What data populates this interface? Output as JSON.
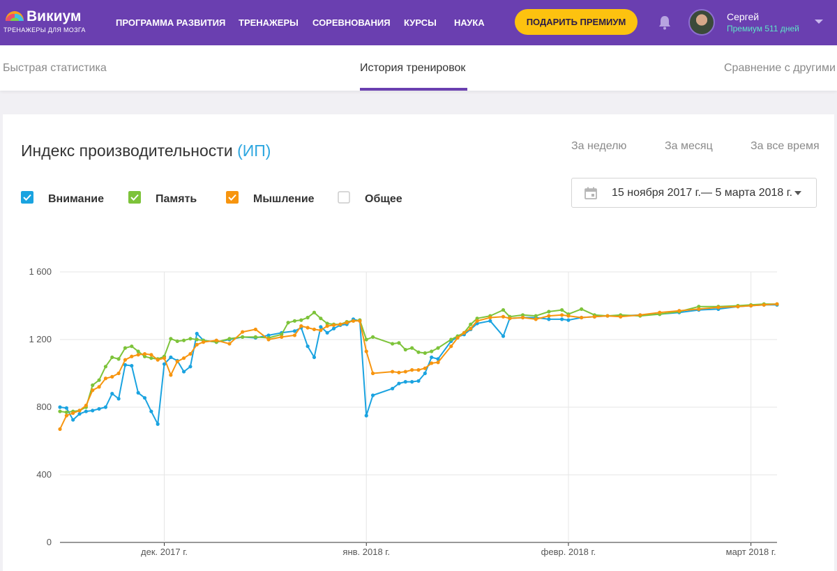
{
  "header": {
    "logo_name": "Викиум",
    "logo_tagline": "ТРЕНАЖЕРЫ ДЛЯ МОЗГА",
    "nav": [
      "ПРОГРАММА РАЗВИТИЯ",
      "ТРЕНАЖЕРЫ",
      "СОРЕВНОВАНИЯ",
      "КУРСЫ",
      "НАУКА"
    ],
    "premium_button": "ПОДАРИТЬ ПРЕМИУМ",
    "user_name": "Сергей",
    "user_status": "Премиум 511 дней",
    "colors": {
      "bar": "#6a3fb0",
      "button": "#fdc20f",
      "status": "#5ee4c8"
    }
  },
  "tabs": {
    "items": [
      "Быстрая статистика",
      "История тренировок",
      "Сравнение с другими"
    ],
    "active": "История тренировок"
  },
  "card": {
    "title": "Индекс производительности",
    "title_abbr": "(ИП)",
    "periods": [
      "За неделю",
      "За месяц",
      "За все время"
    ],
    "legend": [
      {
        "label": "Внимание",
        "checked": true,
        "color": "#1aa3e0"
      },
      {
        "label": "Память",
        "checked": true,
        "color": "#7dc33a"
      },
      {
        "label": "Мышление",
        "checked": true,
        "color": "#f7950f"
      },
      {
        "label": "Общее",
        "checked": false,
        "color": "#cccccc"
      }
    ],
    "date_range": "15 ноября 2017 г.— 5 марта 2018 г."
  },
  "chart_data": {
    "type": "line",
    "x_range": [
      "2017-11-15",
      "2018-03-05"
    ],
    "y_ticks": [
      "0",
      "400",
      "800",
      "1 200",
      "1 600"
    ],
    "ylim": [
      0,
      1600
    ],
    "x_ticks": [
      {
        "label": "дек. 2017 г.",
        "date": "2017-12-01"
      },
      {
        "label": "янв. 2018 г.",
        "date": "2018-01-01"
      },
      {
        "label": "февр. 2018 г.",
        "date": "2018-02-01"
      },
      {
        "label": "март 2018 г.",
        "date": "2018-03-01"
      }
    ],
    "grid": true,
    "series": [
      {
        "name": "Внимание",
        "color": "#1aa3e0",
        "points": [
          [
            "2017-11-15",
            800
          ],
          [
            "2017-11-16",
            795
          ],
          [
            "2017-11-17",
            725
          ],
          [
            "2017-11-18",
            760
          ],
          [
            "2017-11-19",
            775
          ],
          [
            "2017-11-20",
            780
          ],
          [
            "2017-11-21",
            790
          ],
          [
            "2017-11-22",
            800
          ],
          [
            "2017-11-23",
            880
          ],
          [
            "2017-11-24",
            850
          ],
          [
            "2017-11-25",
            1050
          ],
          [
            "2017-11-26",
            1045
          ],
          [
            "2017-11-27",
            885
          ],
          [
            "2017-11-28",
            855
          ],
          [
            "2017-11-29",
            775
          ],
          [
            "2017-11-30",
            700
          ],
          [
            "2017-12-01",
            1055
          ],
          [
            "2017-12-02",
            1095
          ],
          [
            "2017-12-03",
            1075
          ],
          [
            "2017-12-04",
            1010
          ],
          [
            "2017-12-05",
            1040
          ],
          [
            "2017-12-06",
            1235
          ],
          [
            "2017-12-07",
            1195
          ],
          [
            "2017-12-09",
            1185
          ],
          [
            "2017-12-11",
            1200
          ],
          [
            "2017-12-13",
            1215
          ],
          [
            "2017-12-15",
            1210
          ],
          [
            "2017-12-17",
            1225
          ],
          [
            "2017-12-19",
            1240
          ],
          [
            "2017-12-21",
            1250
          ],
          [
            "2017-12-22",
            1270
          ],
          [
            "2017-12-23",
            1160
          ],
          [
            "2017-12-24",
            1095
          ],
          [
            "2017-12-25",
            1275
          ],
          [
            "2017-12-26",
            1240
          ],
          [
            "2017-12-27",
            1265
          ],
          [
            "2017-12-28",
            1285
          ],
          [
            "2017-12-29",
            1290
          ],
          [
            "2017-12-30",
            1320
          ],
          [
            "2017-12-31",
            1310
          ],
          [
            "2018-01-01",
            750
          ],
          [
            "2018-01-02",
            870
          ],
          [
            "2018-01-05",
            910
          ],
          [
            "2018-01-06",
            940
          ],
          [
            "2018-01-07",
            950
          ],
          [
            "2018-01-08",
            950
          ],
          [
            "2018-01-09",
            955
          ],
          [
            "2018-01-10",
            1000
          ],
          [
            "2018-01-11",
            1095
          ],
          [
            "2018-01-12",
            1085
          ],
          [
            "2018-01-14",
            1190
          ],
          [
            "2018-01-15",
            1215
          ],
          [
            "2018-01-16",
            1230
          ],
          [
            "2018-01-17",
            1260
          ],
          [
            "2018-01-18",
            1295
          ],
          [
            "2018-01-20",
            1310
          ],
          [
            "2018-01-22",
            1220
          ],
          [
            "2018-01-23",
            1325
          ],
          [
            "2018-01-25",
            1330
          ],
          [
            "2018-01-27",
            1330
          ],
          [
            "2018-01-29",
            1320
          ],
          [
            "2018-01-31",
            1320
          ],
          [
            "2018-02-01",
            1315
          ],
          [
            "2018-02-03",
            1330
          ],
          [
            "2018-02-05",
            1335
          ],
          [
            "2018-02-07",
            1340
          ],
          [
            "2018-02-09",
            1340
          ],
          [
            "2018-02-12",
            1345
          ],
          [
            "2018-02-15",
            1350
          ],
          [
            "2018-02-18",
            1360
          ],
          [
            "2018-02-21",
            1375
          ],
          [
            "2018-02-24",
            1380
          ],
          [
            "2018-02-27",
            1395
          ],
          [
            "2018-03-01",
            1400
          ],
          [
            "2018-03-03",
            1405
          ],
          [
            "2018-03-05",
            1405
          ]
        ]
      },
      {
        "name": "Память",
        "color": "#7dc33a",
        "points": [
          [
            "2017-11-15",
            775
          ],
          [
            "2017-11-16",
            770
          ],
          [
            "2017-11-17",
            775
          ],
          [
            "2017-11-18",
            780
          ],
          [
            "2017-11-19",
            800
          ],
          [
            "2017-11-20",
            930
          ],
          [
            "2017-11-21",
            960
          ],
          [
            "2017-11-22",
            1040
          ],
          [
            "2017-11-23",
            1095
          ],
          [
            "2017-11-24",
            1085
          ],
          [
            "2017-11-25",
            1150
          ],
          [
            "2017-11-26",
            1160
          ],
          [
            "2017-11-27",
            1130
          ],
          [
            "2017-11-28",
            1100
          ],
          [
            "2017-11-29",
            1090
          ],
          [
            "2017-11-30",
            1085
          ],
          [
            "2017-12-01",
            1100
          ],
          [
            "2017-12-02",
            1205
          ],
          [
            "2017-12-03",
            1190
          ],
          [
            "2017-12-04",
            1195
          ],
          [
            "2017-12-05",
            1205
          ],
          [
            "2017-12-06",
            1200
          ],
          [
            "2017-12-07",
            1195
          ],
          [
            "2017-12-09",
            1185
          ],
          [
            "2017-12-11",
            1205
          ],
          [
            "2017-12-13",
            1215
          ],
          [
            "2017-12-15",
            1215
          ],
          [
            "2017-12-17",
            1210
          ],
          [
            "2017-12-19",
            1230
          ],
          [
            "2017-12-20",
            1300
          ],
          [
            "2017-12-21",
            1310
          ],
          [
            "2017-12-22",
            1315
          ],
          [
            "2017-12-23",
            1330
          ],
          [
            "2017-12-24",
            1360
          ],
          [
            "2017-12-25",
            1325
          ],
          [
            "2017-12-26",
            1295
          ],
          [
            "2017-12-27",
            1290
          ],
          [
            "2017-12-28",
            1290
          ],
          [
            "2017-12-29",
            1305
          ],
          [
            "2017-12-30",
            1310
          ],
          [
            "2017-12-31",
            1315
          ],
          [
            "2018-01-01",
            1200
          ],
          [
            "2018-01-02",
            1215
          ],
          [
            "2018-01-05",
            1175
          ],
          [
            "2018-01-06",
            1180
          ],
          [
            "2018-01-07",
            1140
          ],
          [
            "2018-01-08",
            1150
          ],
          [
            "2018-01-09",
            1125
          ],
          [
            "2018-01-10",
            1120
          ],
          [
            "2018-01-11",
            1130
          ],
          [
            "2018-01-12",
            1150
          ],
          [
            "2018-01-14",
            1200
          ],
          [
            "2018-01-15",
            1220
          ],
          [
            "2018-01-16",
            1240
          ],
          [
            "2018-01-17",
            1290
          ],
          [
            "2018-01-18",
            1325
          ],
          [
            "2018-01-20",
            1340
          ],
          [
            "2018-01-22",
            1375
          ],
          [
            "2018-01-23",
            1335
          ],
          [
            "2018-01-25",
            1345
          ],
          [
            "2018-01-27",
            1340
          ],
          [
            "2018-01-29",
            1365
          ],
          [
            "2018-01-31",
            1375
          ],
          [
            "2018-02-01",
            1350
          ],
          [
            "2018-02-03",
            1380
          ],
          [
            "2018-02-05",
            1345
          ],
          [
            "2018-02-07",
            1340
          ],
          [
            "2018-02-09",
            1345
          ],
          [
            "2018-02-12",
            1340
          ],
          [
            "2018-02-15",
            1350
          ],
          [
            "2018-02-18",
            1365
          ],
          [
            "2018-02-21",
            1395
          ],
          [
            "2018-02-24",
            1395
          ],
          [
            "2018-02-27",
            1400
          ],
          [
            "2018-03-01",
            1405
          ],
          [
            "2018-03-03",
            1410
          ],
          [
            "2018-03-05",
            1410
          ]
        ]
      },
      {
        "name": "Мышление",
        "color": "#f7950f",
        "points": [
          [
            "2017-11-15",
            670
          ],
          [
            "2017-11-16",
            750
          ],
          [
            "2017-11-17",
            765
          ],
          [
            "2017-11-18",
            780
          ],
          [
            "2017-11-19",
            810
          ],
          [
            "2017-11-20",
            900
          ],
          [
            "2017-11-21",
            920
          ],
          [
            "2017-11-22",
            970
          ],
          [
            "2017-11-23",
            980
          ],
          [
            "2017-11-24",
            1000
          ],
          [
            "2017-11-25",
            1080
          ],
          [
            "2017-11-26",
            1100
          ],
          [
            "2017-11-27",
            1110
          ],
          [
            "2017-11-28",
            1115
          ],
          [
            "2017-11-29",
            1110
          ],
          [
            "2017-11-30",
            1080
          ],
          [
            "2017-12-01",
            1090
          ],
          [
            "2017-12-02",
            990
          ],
          [
            "2017-12-03",
            1070
          ],
          [
            "2017-12-04",
            1090
          ],
          [
            "2017-12-05",
            1115
          ],
          [
            "2017-12-06",
            1170
          ],
          [
            "2017-12-07",
            1185
          ],
          [
            "2017-12-09",
            1195
          ],
          [
            "2017-12-11",
            1175
          ],
          [
            "2017-12-13",
            1245
          ],
          [
            "2017-12-15",
            1260
          ],
          [
            "2017-12-17",
            1200
          ],
          [
            "2017-12-19",
            1215
          ],
          [
            "2017-12-21",
            1225
          ],
          [
            "2017-12-22",
            1280
          ],
          [
            "2017-12-23",
            1270
          ],
          [
            "2017-12-24",
            1260
          ],
          [
            "2017-12-25",
            1255
          ],
          [
            "2017-12-26",
            1280
          ],
          [
            "2017-12-27",
            1285
          ],
          [
            "2017-12-28",
            1290
          ],
          [
            "2017-12-29",
            1300
          ],
          [
            "2017-12-30",
            1310
          ],
          [
            "2017-12-31",
            1310
          ],
          [
            "2018-01-01",
            1130
          ],
          [
            "2018-01-02",
            1000
          ],
          [
            "2018-01-05",
            1010
          ],
          [
            "2018-01-06",
            1005
          ],
          [
            "2018-01-07",
            1010
          ],
          [
            "2018-01-08",
            1020
          ],
          [
            "2018-01-09",
            1020
          ],
          [
            "2018-01-10",
            1030
          ],
          [
            "2018-01-11",
            1060
          ],
          [
            "2018-01-12",
            1065
          ],
          [
            "2018-01-14",
            1160
          ],
          [
            "2018-01-15",
            1210
          ],
          [
            "2018-01-16",
            1240
          ],
          [
            "2018-01-17",
            1265
          ],
          [
            "2018-01-18",
            1310
          ],
          [
            "2018-01-20",
            1330
          ],
          [
            "2018-01-22",
            1335
          ],
          [
            "2018-01-23",
            1325
          ],
          [
            "2018-01-25",
            1330
          ],
          [
            "2018-01-27",
            1320
          ],
          [
            "2018-01-29",
            1340
          ],
          [
            "2018-01-31",
            1345
          ],
          [
            "2018-02-01",
            1340
          ],
          [
            "2018-02-03",
            1330
          ],
          [
            "2018-02-05",
            1335
          ],
          [
            "2018-02-07",
            1340
          ],
          [
            "2018-02-09",
            1335
          ],
          [
            "2018-02-12",
            1345
          ],
          [
            "2018-02-15",
            1360
          ],
          [
            "2018-02-18",
            1370
          ],
          [
            "2018-02-21",
            1380
          ],
          [
            "2018-02-24",
            1390
          ],
          [
            "2018-02-27",
            1395
          ],
          [
            "2018-03-01",
            1400
          ],
          [
            "2018-03-03",
            1405
          ],
          [
            "2018-03-05",
            1410
          ]
        ]
      }
    ]
  }
}
